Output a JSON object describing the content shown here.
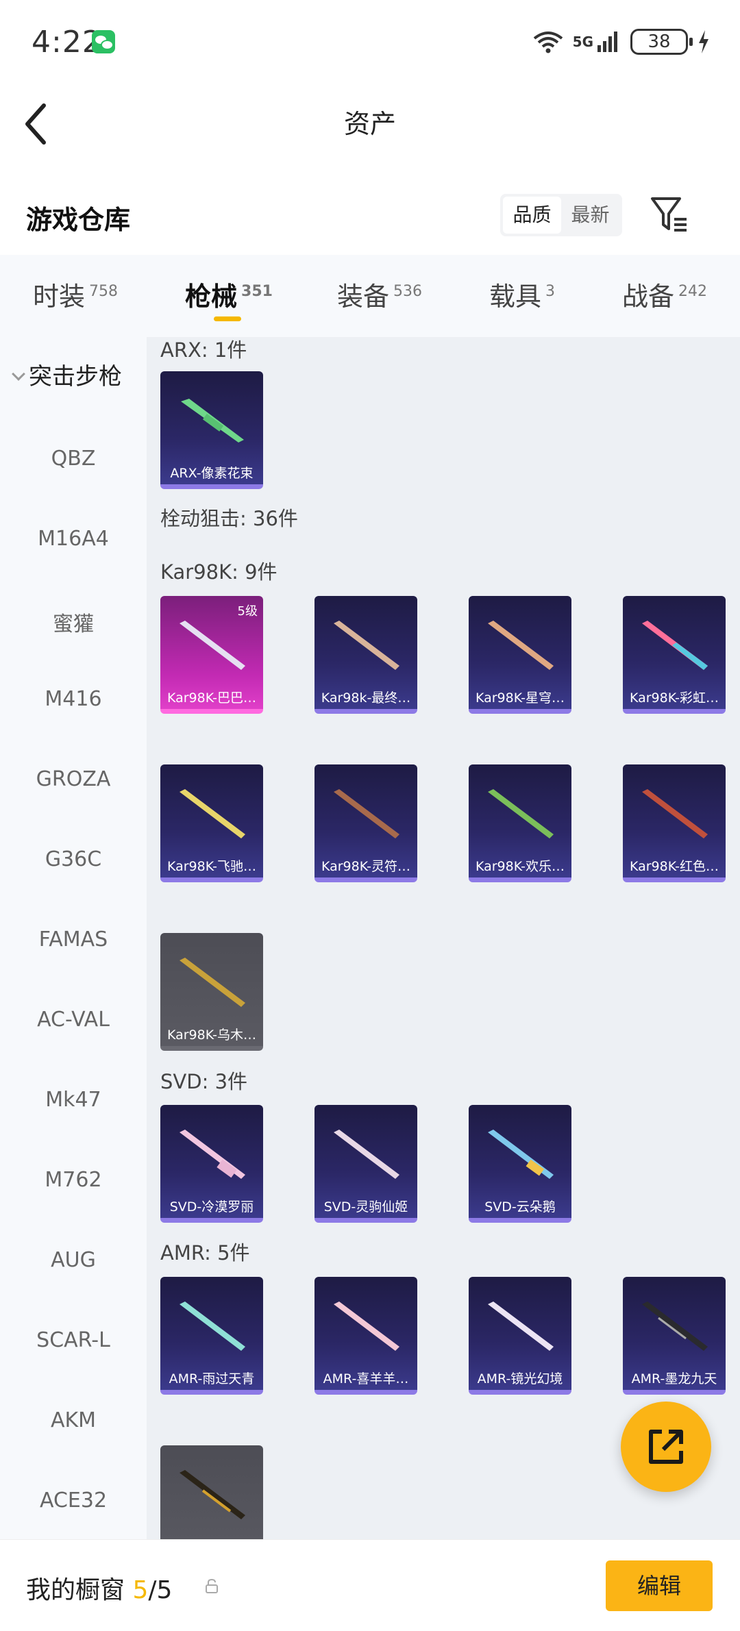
{
  "status": {
    "time": "4:22",
    "network": "5G",
    "battery": "38"
  },
  "header": {
    "title": "资产"
  },
  "warehouse": {
    "title": "游戏仓库",
    "sort": {
      "quality": "品质",
      "latest": "最新"
    }
  },
  "tabs": [
    {
      "label": "时装",
      "count": "758"
    },
    {
      "label": "枪械",
      "count": "351"
    },
    {
      "label": "装备",
      "count": "536"
    },
    {
      "label": "载具",
      "count": "3"
    },
    {
      "label": "战备",
      "count": "242"
    }
  ],
  "sidebar": {
    "group": "突击步枪",
    "items": [
      "QBZ",
      "M16A4",
      "蜜獾",
      "M416",
      "GROZA",
      "G36C",
      "FAMAS",
      "AC-VAL",
      "Mk47",
      "M762",
      "AUG",
      "SCAR-L",
      "AKM",
      "ACE32"
    ]
  },
  "content": {
    "arx": {
      "label": "ARX: 1件",
      "items": [
        "ARX-像素花束"
      ]
    },
    "sniper": {
      "label": "栓动狙击: 36件"
    },
    "kar98k": {
      "label": "Kar98K: 9件",
      "level": "5级",
      "items": [
        "Kar98K-巴巴…",
        "Kar98k-最终…",
        "Kar98K-星穹…",
        "Kar98K-彩虹…",
        "Kar98K-飞驰…",
        "Kar98K-灵符…",
        "Kar98K-欢乐…",
        "Kar98K-红色…",
        "Kar98K-乌木…"
      ]
    },
    "svd": {
      "label": "SVD: 3件",
      "items": [
        "SVD-冷漠罗丽",
        "SVD-灵驹仙姬",
        "SVD-云朵鹅"
      ]
    },
    "amr": {
      "label": "AMR: 5件",
      "items": [
        "AMR-雨过天青",
        "AMR-喜羊羊…",
        "AMR-镜光幻境",
        "AMR-墨龙九天"
      ]
    }
  },
  "bottom": {
    "label": "我的橱窗",
    "count": "5",
    "total": "/5",
    "edit": "编辑"
  },
  "colors": {
    "accent": "#F5B800",
    "fab": "#FBB415"
  }
}
